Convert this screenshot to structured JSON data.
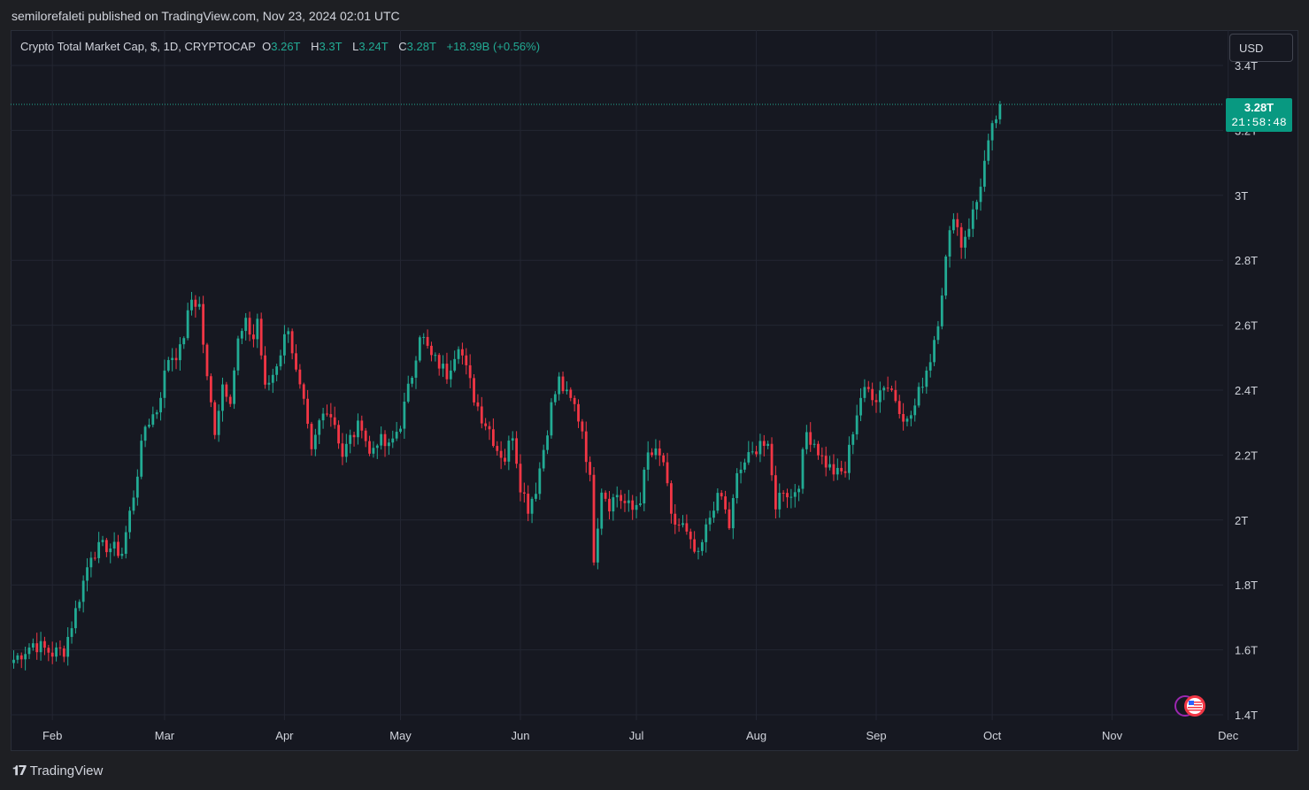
{
  "caption": "semilorefaleti published on TradingView.com, Nov 23, 2024 02:01 UTC",
  "legend": {
    "symbol": "Crypto Total Market Cap, $, 1D, CRYPTOCAP",
    "o_label": "O",
    "o_value": "3.26T",
    "h_label": "H",
    "h_value": "3.3T",
    "l_label": "L",
    "l_value": "3.24T",
    "c_label": "C",
    "c_value": "3.28T",
    "change": "+18.39B (+0.56%)"
  },
  "currency_button": "USD",
  "last_price": {
    "value": "3.28T",
    "countdown": "21:58:48"
  },
  "footer": {
    "brand": "TradingView",
    "logo_icon": "tradingview-logo-icon"
  },
  "colors": {
    "up": "#22ab94",
    "down": "#f23645",
    "background": "#161821",
    "grid": "#232632",
    "badge": "#089981"
  },
  "chart_data": {
    "type": "candlestick",
    "y_unit": "T USD",
    "ylim": [
      1.4,
      3.42
    ],
    "y_ticks": [
      {
        "v": 1.4,
        "label": "1.4T"
      },
      {
        "v": 1.6,
        "label": "1.6T"
      },
      {
        "v": 1.8,
        "label": "1.8T"
      },
      {
        "v": 2.0,
        "label": "2T"
      },
      {
        "v": 2.2,
        "label": "2.2T"
      },
      {
        "v": 2.4,
        "label": "2.4T"
      },
      {
        "v": 2.6,
        "label": "2.6T"
      },
      {
        "v": 2.8,
        "label": "2.8T"
      },
      {
        "v": 3.0,
        "label": "3T"
      },
      {
        "v": 3.2,
        "label": "3.2T"
      },
      {
        "v": 3.4,
        "label": "3.4T"
      }
    ],
    "x_ticks": [
      {
        "day": 10,
        "label": "Feb"
      },
      {
        "day": 39,
        "label": "Mar"
      },
      {
        "day": 70,
        "label": "Apr"
      },
      {
        "day": 100,
        "label": "May"
      },
      {
        "day": 131,
        "label": "Jun"
      },
      {
        "day": 161,
        "label": "Jul"
      },
      {
        "day": 192,
        "label": "Aug"
      },
      {
        "day": 223,
        "label": "Sep"
      },
      {
        "day": 253,
        "label": "Oct"
      },
      {
        "day": 284,
        "label": "Nov"
      },
      {
        "day": 314,
        "label": "Dec"
      }
    ],
    "grid": true,
    "last_close": 3.28,
    "anchors": [
      [
        0,
        1.57
      ],
      [
        5,
        1.62
      ],
      [
        10,
        1.59
      ],
      [
        13,
        1.6
      ],
      [
        16,
        1.72
      ],
      [
        20,
        1.9
      ],
      [
        24,
        1.92
      ],
      [
        28,
        1.9
      ],
      [
        31,
        2.08
      ],
      [
        34,
        2.29
      ],
      [
        37,
        2.34
      ],
      [
        40,
        2.5
      ],
      [
        43,
        2.52
      ],
      [
        46,
        2.68
      ],
      [
        48,
        2.66
      ],
      [
        50,
        2.43
      ],
      [
        52,
        2.28
      ],
      [
        54,
        2.42
      ],
      [
        56,
        2.38
      ],
      [
        58,
        2.55
      ],
      [
        60,
        2.6
      ],
      [
        62,
        2.56
      ],
      [
        63,
        2.62
      ],
      [
        65,
        2.4
      ],
      [
        67,
        2.45
      ],
      [
        69,
        2.52
      ],
      [
        71,
        2.6
      ],
      [
        73,
        2.45
      ],
      [
        75,
        2.35
      ],
      [
        77,
        2.2
      ],
      [
        79,
        2.3
      ],
      [
        81,
        2.35
      ],
      [
        83,
        2.3
      ],
      [
        85,
        2.2
      ],
      [
        87,
        2.25
      ],
      [
        90,
        2.3
      ],
      [
        92,
        2.2
      ],
      [
        94,
        2.25
      ],
      [
        97,
        2.22
      ],
      [
        100,
        2.3
      ],
      [
        103,
        2.45
      ],
      [
        105,
        2.58
      ],
      [
        108,
        2.5
      ],
      [
        110,
        2.48
      ],
      [
        112,
        2.45
      ],
      [
        115,
        2.55
      ],
      [
        117,
        2.46
      ],
      [
        119,
        2.38
      ],
      [
        121,
        2.32
      ],
      [
        123,
        2.28
      ],
      [
        125,
        2.22
      ],
      [
        127,
        2.19
      ],
      [
        129,
        2.27
      ],
      [
        131,
        2.11
      ],
      [
        133,
        2.04
      ],
      [
        135,
        2.1
      ],
      [
        137,
        2.22
      ],
      [
        139,
        2.35
      ],
      [
        141,
        2.43
      ],
      [
        143,
        2.38
      ],
      [
        145,
        2.35
      ],
      [
        147,
        2.28
      ],
      [
        149,
        2.12
      ],
      [
        150,
        1.89
      ],
      [
        152,
        2.1
      ],
      [
        154,
        2.05
      ],
      [
        156,
        2.08
      ],
      [
        158,
        2.05
      ],
      [
        160,
        2.03
      ],
      [
        162,
        2.07
      ],
      [
        164,
        2.2
      ],
      [
        166,
        2.2
      ],
      [
        168,
        2.18
      ],
      [
        170,
        2.0
      ],
      [
        171,
        1.99
      ],
      [
        173,
        1.98
      ],
      [
        175,
        1.92
      ],
      [
        177,
        1.88
      ],
      [
        179,
        1.97
      ],
      [
        181,
        2.05
      ],
      [
        183,
        2.07
      ],
      [
        185,
        1.98
      ],
      [
        187,
        2.13
      ],
      [
        189,
        2.18
      ],
      [
        191,
        2.2
      ],
      [
        193,
        2.25
      ],
      [
        195,
        2.21
      ],
      [
        197,
        2.05
      ],
      [
        199,
        2.1
      ],
      [
        201,
        2.07
      ],
      [
        203,
        2.12
      ],
      [
        205,
        2.27
      ],
      [
        207,
        2.24
      ],
      [
        209,
        2.19
      ],
      [
        211,
        2.16
      ],
      [
        213,
        2.14
      ],
      [
        215,
        2.15
      ],
      [
        217,
        2.28
      ],
      [
        219,
        2.38
      ],
      [
        221,
        2.4
      ],
      [
        223,
        2.38
      ],
      [
        225,
        2.42
      ],
      [
        227,
        2.4
      ],
      [
        229,
        2.35
      ],
      [
        231,
        2.3
      ],
      [
        233,
        2.35
      ],
      [
        235,
        2.43
      ],
      [
        237,
        2.5
      ],
      [
        239,
        2.62
      ],
      [
        241,
        2.8
      ],
      [
        243,
        2.95
      ],
      [
        245,
        2.85
      ],
      [
        247,
        2.91
      ],
      [
        249,
        2.98
      ],
      [
        251,
        3.1
      ],
      [
        253,
        3.2
      ],
      [
        255,
        3.28
      ]
    ]
  }
}
